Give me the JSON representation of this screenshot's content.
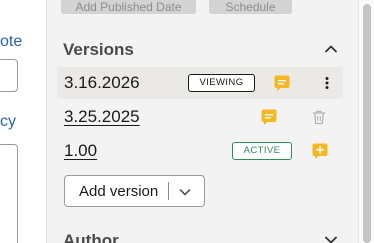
{
  "left": {
    "note_label": "ote",
    "policy_label": "cy"
  },
  "toolbar": {
    "add_published_date": "Add Published Date",
    "schedule": "Schedule"
  },
  "versions": {
    "title": "Versions",
    "rows": [
      {
        "label": "3.16.2026",
        "badge": "VIEWING",
        "underlined": false
      },
      {
        "label": "3.25.2025",
        "badge": "",
        "underlined": true
      },
      {
        "label": "1.00",
        "badge": "ACTIVE",
        "underlined": true
      }
    ],
    "add_version_label": "Add version"
  },
  "author": {
    "title": "Author"
  },
  "colors": {
    "accent_link": "#2a63b8",
    "comment_icon": "#f5b820",
    "active_badge": "#2e8b57",
    "sidebar_bg": "#f3f3f3",
    "selected_row_bg": "#ebe9e6"
  },
  "icons": {
    "section_collapse": "chevron-up-icon",
    "section_expand": "chevron-down-icon",
    "comment": "comment-icon",
    "add_comment": "add-comment-icon",
    "more": "more-vertical-icon",
    "delete": "trash-icon",
    "dropdown": "chevron-down-icon"
  }
}
